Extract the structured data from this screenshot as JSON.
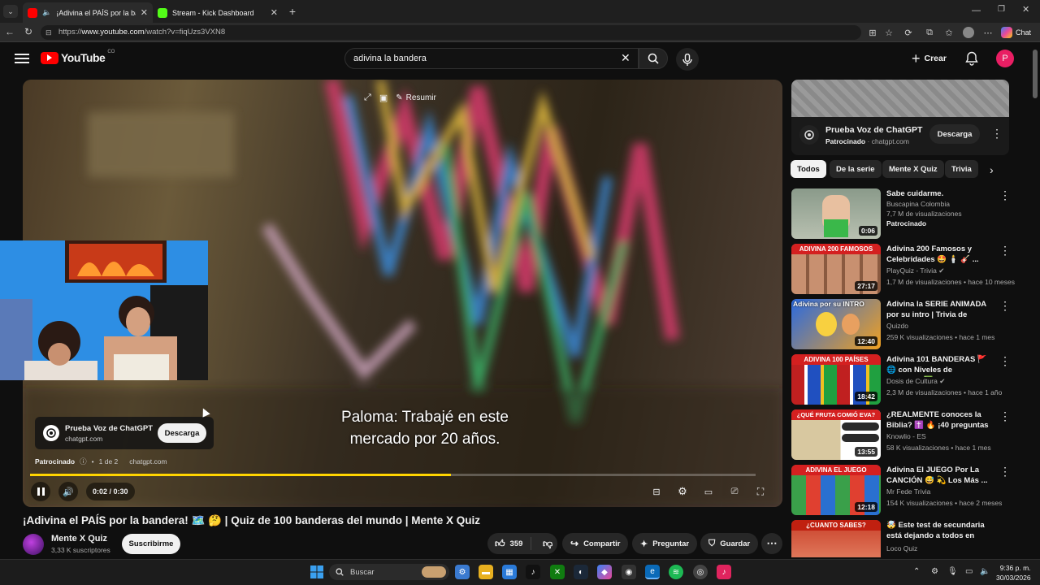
{
  "browser": {
    "tabs": [
      {
        "title": "¡Adivina el PAÍS por la bander",
        "active": true
      },
      {
        "title": "Stream - Kick Dashboard",
        "active": false
      }
    ],
    "url_prefix": "https://",
    "url_host": "www.youtube.com",
    "url_path": "/watch?v=fiqUzs3VXN8",
    "chat_label": "Chat"
  },
  "youtube": {
    "logo_text": "YouTube",
    "country_code": "CO",
    "search_value": "adivina la bandera",
    "create_label": "Crear",
    "avatar_letter": "P"
  },
  "player": {
    "overlay_summary_label": "Resumir",
    "subtitle_line1": "Paloma: Trabajé en este",
    "subtitle_line2": "mercado por 20 años.",
    "ad": {
      "title": "Prueba Voz de ChatGPT",
      "domain": "chatgpt.com",
      "button": "Descarga",
      "sponsored": "Patrocinado",
      "counter": "1 de 2",
      "link": "chatgpt.com"
    },
    "time": "0:02 / 0:30",
    "progress": 0.58
  },
  "video": {
    "title": "¡Adivina el PAÍS por la bandera! 🗺️ 🤔 | Quiz de 100 banderas del mundo | Mente X Quiz",
    "channel": "Mente X Quiz",
    "subscribers": "3,33 K suscriptores",
    "subscribe_label": "Suscribirme",
    "likes": "359",
    "share_label": "Compartir",
    "ask_label": "Preguntar",
    "save_label": "Guardar"
  },
  "sidebar": {
    "ad": {
      "title": "Prueba Voz de ChatGPT",
      "sponsored": "Patrocinado",
      "domain": "chatgpt.com",
      "button": "Descarga"
    },
    "chips": [
      "Todos",
      "De la serie",
      "Mente X Quiz",
      "Trivia"
    ],
    "recs": [
      {
        "title": "Sabe cuidarme.",
        "channel": "Buscapina Colombia",
        "meta": "7,7 M de visualizaciones",
        "extra": "Patrocinado",
        "duration": "0:06",
        "thumb_text": ""
      },
      {
        "title": "Adivina 200 Famosos y Celebridades 🤩 🕯️ 🎸 ...",
        "channel": "PlayQuiz - Trivia",
        "meta": "1,7 M de visualizaciones • hace 10 meses",
        "extra": "",
        "duration": "27:17",
        "thumb_text": "ADIVINA 200 FAMOSOS"
      },
      {
        "title": "Adivina la SERIE ANIMADA por su intro | Trivia de Series",
        "channel": "Quizdo",
        "meta": "259 K visualizaciones • hace 1 mes",
        "extra": "",
        "duration": "12:40",
        "thumb_text": "Adivina por su INTRO"
      },
      {
        "title": "Adivina 101 BANDERAS 🚩 🌐 con Niveles de Dificultad ✅-...",
        "channel": "Dosis de Cultura",
        "meta": "2,3 M de visualizaciones • hace 1 año",
        "extra": "",
        "duration": "18:42",
        "thumb_text": "ADIVINA 100 PAÍSES"
      },
      {
        "title": "¿REALMENTE conoces la Biblia? ✝️ 🔥 ¡40 preguntas ...",
        "channel": "Knowlio - ES",
        "meta": "58 K visualizaciones • hace 1 mes",
        "extra": "",
        "duration": "13:55",
        "thumb_text": "¿QUÉ FRUTA COMIÓ EVA?"
      },
      {
        "title": "Adivina El JUEGO Por La CANCIÓN 😅 💫 Los Más ...",
        "channel": "Mr Fede Trivia",
        "meta": "154 K visualizaciones • hace 2 meses",
        "extra": "",
        "duration": "12:18",
        "thumb_text": "ADIVINA EL JUEGO"
      },
      {
        "title": "🤯 Este test de secundaria está dejando a todos en ridículo",
        "channel": "Loco Quiz",
        "meta": "",
        "extra": "",
        "duration": "",
        "thumb_text": "¿CUANTO SABES?"
      }
    ]
  },
  "taskbar": {
    "search_label": "Buscar",
    "time": "9:36 p. m.",
    "date": "30/03/2026"
  },
  "colors": {
    "accent": "#ff0000",
    "progress": "#ffd400",
    "avatar": "#e91e63"
  }
}
